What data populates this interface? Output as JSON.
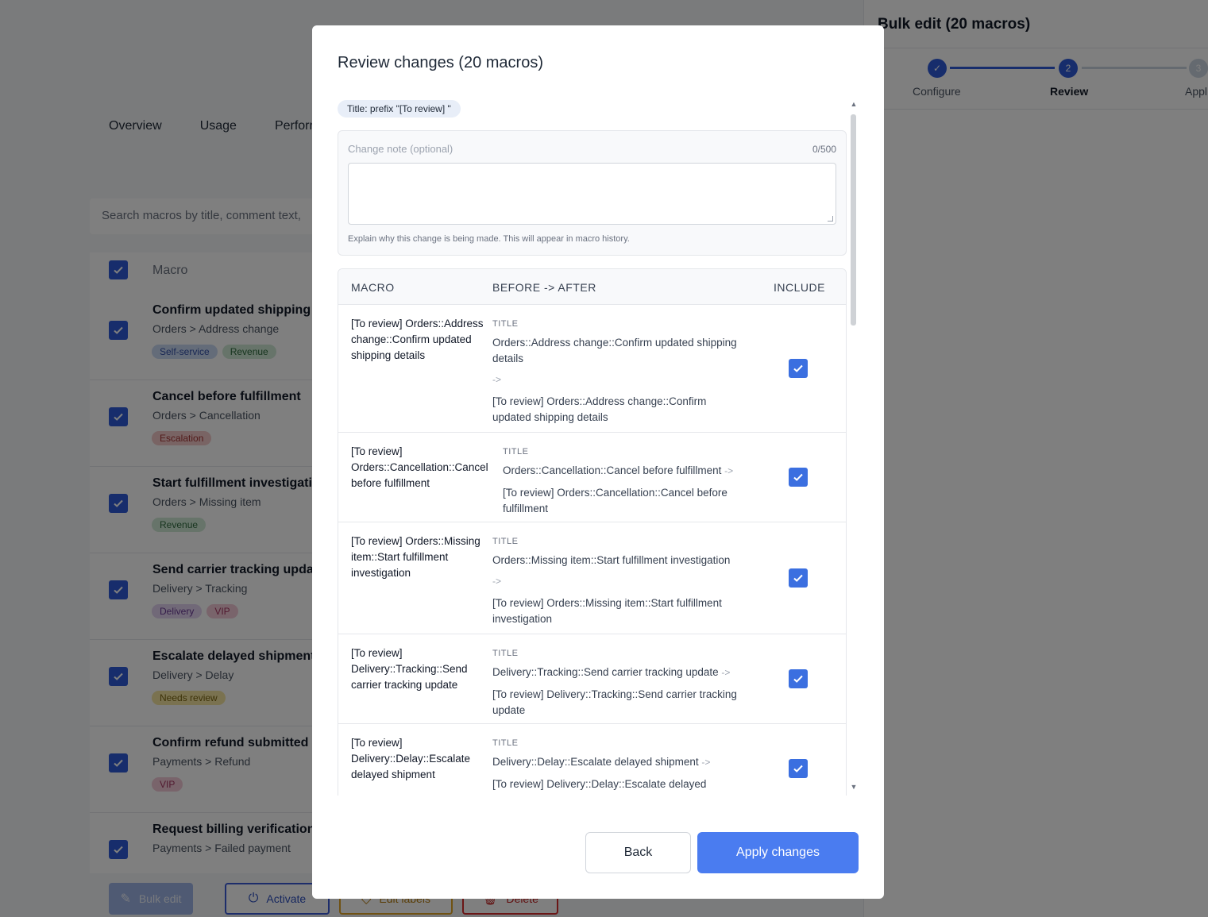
{
  "background": {
    "tabs": [
      "Overview",
      "Usage",
      "Perform"
    ],
    "search_placeholder": "Search macros by title, comment text,",
    "list_header_label": "Macro",
    "rows": [
      {
        "title": "Confirm updated shipping de",
        "path": "Orders > Address change",
        "tags": [
          {
            "label": "Self-service",
            "bg": "#c9d8f3",
            "fg": "#3350a8"
          },
          {
            "label": "Revenue",
            "bg": "#cfe8d4",
            "fg": "#2f6b3e"
          }
        ]
      },
      {
        "title": "Cancel before fulfillment",
        "path": "Orders > Cancellation",
        "tags": [
          {
            "label": "Escalation",
            "bg": "#f3c9c9",
            "fg": "#a33434"
          }
        ]
      },
      {
        "title": "Start fulfillment investigation",
        "path": "Orders > Missing item",
        "tags": [
          {
            "label": "Revenue",
            "bg": "#cfe8d4",
            "fg": "#2f6b3e"
          }
        ]
      },
      {
        "title": "Send carrier tracking update",
        "path": "Delivery > Tracking",
        "tags": [
          {
            "label": "Delivery",
            "bg": "#e2d2f1",
            "fg": "#6a3a94"
          },
          {
            "label": "VIP",
            "bg": "#f3c9d6",
            "fg": "#a33461"
          }
        ]
      },
      {
        "title": "Escalate delayed shipment",
        "path": "Delivery > Delay",
        "tags": [
          {
            "label": "Needs review",
            "bg": "#f4e5a0",
            "fg": "#7a6410"
          }
        ]
      },
      {
        "title": "Confirm refund submitted",
        "path": "Payments > Refund",
        "tags": [
          {
            "label": "VIP",
            "bg": "#f3c9d6",
            "fg": "#a33461"
          }
        ]
      },
      {
        "title": "Request billing verification",
        "path": "Payments > Failed payment",
        "tags": []
      }
    ],
    "bottom_bar": {
      "bulk_edit": "Bulk edit",
      "activate": "Activate",
      "edit_labels": "Edit labels",
      "delete": "Delete"
    }
  },
  "side_panel": {
    "title": "Bulk edit (20 macros)",
    "steps": [
      {
        "label": "Configure",
        "marker": "✓"
      },
      {
        "label": "Review",
        "marker": "2"
      },
      {
        "label": "Appl",
        "marker": "3"
      }
    ]
  },
  "modal": {
    "title": "Review changes (20 macros)",
    "chip": "Title: prefix \"[To review] \"",
    "note": {
      "label": "Change note (optional)",
      "counter": "0/500",
      "value": "",
      "help": "Explain why this change is being made. This will appear in macro history."
    },
    "table": {
      "headers": {
        "macro": "MACRO",
        "before_after": "BEFORE -> AFTER",
        "include": "INCLUDE"
      },
      "field_label": "TITLE",
      "arrow": "->",
      "rows": [
        {
          "macro": "[To review] Orders::Address change::Confirm updated shipping details",
          "before": "Orders::Address change::Confirm updated shipping details",
          "after": "[To review] Orders::Address change::Confirm updated shipping details",
          "include": true
        },
        {
          "macro": "[To review] Orders::Cancellation::Cancel before fulfillment",
          "before": "Orders::Cancellation::Cancel before fulfillment",
          "after": "[To review] Orders::Cancellation::Cancel before fulfillment",
          "include": true
        },
        {
          "macro": "[To review] Orders::Missing item::Start fulfillment investigation",
          "before": "Orders::Missing item::Start fulfillment investigation",
          "after": "[To review] Orders::Missing item::Start fulfillment investigation",
          "include": true
        },
        {
          "macro": "[To review] Delivery::Tracking::Send carrier tracking update",
          "before": "Delivery::Tracking::Send carrier tracking update",
          "after": "[To review] Delivery::Tracking::Send carrier tracking update",
          "include": true
        },
        {
          "macro": "[To review] Delivery::Delay::Escalate delayed shipment",
          "before": "Delivery::Delay::Escalate delayed shipment",
          "after": "[To review] Delivery::Delay::Escalate delayed shipment",
          "include": true
        }
      ]
    },
    "buttons": {
      "back": "Back",
      "apply": "Apply changes"
    }
  }
}
